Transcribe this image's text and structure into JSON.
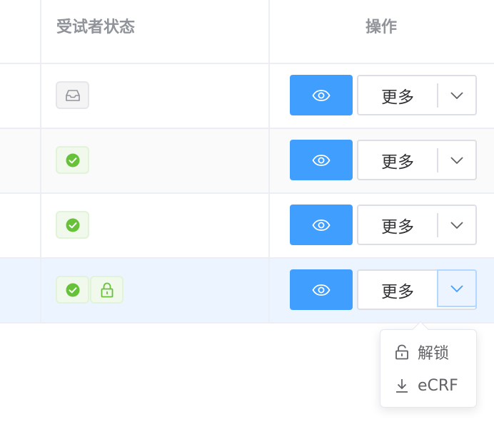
{
  "table": {
    "headers": {
      "status": "受试者状态",
      "actions": "操作"
    },
    "rows": [
      {
        "status_tags": [
          "inbox-icon"
        ],
        "more_label": "更多"
      },
      {
        "status_tags": [
          "check-circle-icon"
        ],
        "more_label": "更多"
      },
      {
        "status_tags": [
          "check-circle-icon"
        ],
        "more_label": "更多"
      },
      {
        "status_tags": [
          "check-circle-icon",
          "lock-icon"
        ],
        "more_label": "更多"
      }
    ]
  },
  "dropdown_menu": {
    "items": [
      {
        "label": "解锁",
        "icon": "unlock-icon"
      },
      {
        "label": "eCRF",
        "icon": "download-icon"
      }
    ]
  },
  "colors": {
    "primary": "#409eff",
    "success": "#67c23a",
    "row_hover": "#ecf5ff",
    "header_text": "#909399"
  }
}
